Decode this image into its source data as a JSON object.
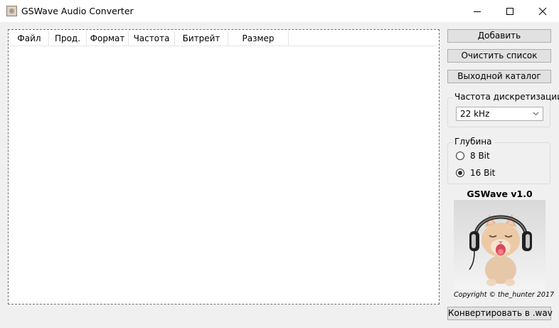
{
  "window": {
    "title": "GSWave Audio Converter",
    "icon": "app-icon",
    "controls": [
      "minimize-icon",
      "maximize-icon",
      "close-icon"
    ]
  },
  "list": {
    "columns": [
      "Файл",
      "Прод.",
      "Формат",
      "Частота",
      "Битрейт",
      "Размер"
    ]
  },
  "buttons": {
    "add": "Добавить",
    "clear": "Очистить список",
    "output": "Выходной каталог",
    "convert": "Конвертировать в .wav"
  },
  "sample_rate": {
    "label": "Частота дискретизации",
    "selected": "22 kHz"
  },
  "depth": {
    "label": "Глубина",
    "options": [
      {
        "label": "8 Bit",
        "checked": false
      },
      {
        "label": "16 Bit",
        "checked": true
      }
    ]
  },
  "promo": {
    "title": "GSWave v1.0",
    "copyright": "Copyright © the_hunter 2017"
  },
  "colors": {
    "window_bg": "#f0f0f0",
    "button_bg": "#e1e1e1",
    "button_border": "#adadad"
  }
}
